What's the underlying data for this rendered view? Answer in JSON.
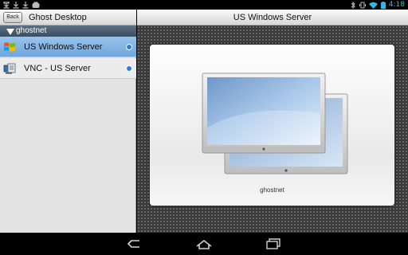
{
  "status_bar": {
    "time": "4:18",
    "left_icons": [
      "download-icon",
      "download-icon",
      "download-icon",
      "gamepad-icon"
    ],
    "right_icons": [
      "bluetooth-icon",
      "vibrate-icon",
      "wifi-icon",
      "battery-icon"
    ]
  },
  "left_pane": {
    "back_label": "Back",
    "title": "Ghost Desktop",
    "group_label": "ghostnet",
    "connections": [
      {
        "label": "US Windows Server",
        "icon": "windows-logo-icon",
        "selected": true
      },
      {
        "label": "VNC - US Server",
        "icon": "vnc-icon",
        "selected": false
      }
    ]
  },
  "right_pane": {
    "title": "US Windows Server",
    "card_caption": "ghostnet"
  },
  "nav_bar": {
    "buttons": [
      "back-nav-icon",
      "home-nav-icon",
      "recent-apps-icon"
    ]
  },
  "colors": {
    "accent_blue": "#33b5e5",
    "selection": "#8ab8e6",
    "group_header": "#4a5b6d"
  }
}
